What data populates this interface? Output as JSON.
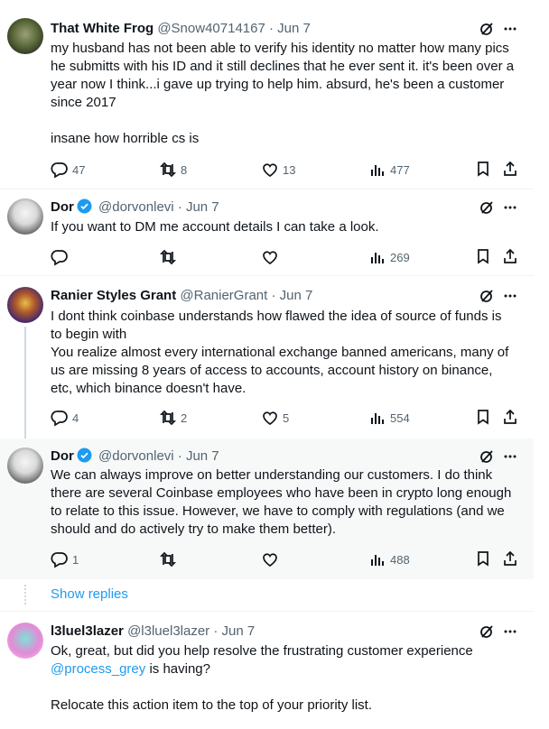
{
  "tweets": [
    {
      "name": "That White Frog",
      "handle": "@Snow40714167",
      "date": "· Jun 7",
      "verified": false,
      "text": "my husband has not been able to verify his identity no matter how many pics he submitts with his ID and it still declines that he ever sent it. it's been over a year now I think...i gave up trying to help him. absurd, he's been a customer since 2017\n\ninsane how horrible cs is",
      "replies": "47",
      "reposts": "8",
      "likes": "13",
      "views": "477"
    },
    {
      "name": "Dor",
      "handle": "@dorvonlevi",
      "date": "· Jun 7",
      "verified": true,
      "text": "If you want to DM me account details I can take a look.",
      "replies": "",
      "reposts": "",
      "likes": "",
      "views": "269"
    },
    {
      "name": "Ranier Styles Grant",
      "handle": "@RanierGrant",
      "date": "· Jun 7",
      "verified": false,
      "text": "I dont think coinbase understands how flawed the idea of source of funds is to begin with\nYou realize almost every international exchange banned americans, many of us are missing 8 years of access to accounts, account history on binance, etc, which binance doesn't have.",
      "replies": "4",
      "reposts": "2",
      "likes": "5",
      "views": "554"
    },
    {
      "name": "Dor",
      "handle": "@dorvonlevi",
      "date": "· Jun 7",
      "verified": true,
      "text": "We can always improve on better understanding our customers. I do think there are several Coinbase employees who have been in crypto long enough to relate to this issue. However, we have to comply with regulations (and we should and do actively try to make them better).",
      "replies": "1",
      "reposts": "",
      "likes": "",
      "views": "488"
    },
    {
      "name": "l3luel3lazer",
      "handle": "@l3luel3lazer",
      "date": "· Jun 7",
      "verified": false,
      "text_pre": "Ok, great, but did you help resolve the frustrating customer experience ",
      "mention": "@process_grey",
      "text_post": " is having?\n\nRelocate this action item to the top of your priority list."
    }
  ],
  "show_replies": "Show replies",
  "colors": {
    "link": "#1d9bf0",
    "secondary": "#536471",
    "verified": "#1d9bf0"
  },
  "icons": [
    "grok-icon",
    "more-icon",
    "reply-icon",
    "repost-icon",
    "like-icon",
    "views-icon",
    "bookmark-icon",
    "share-icon",
    "verified-badge-icon"
  ]
}
